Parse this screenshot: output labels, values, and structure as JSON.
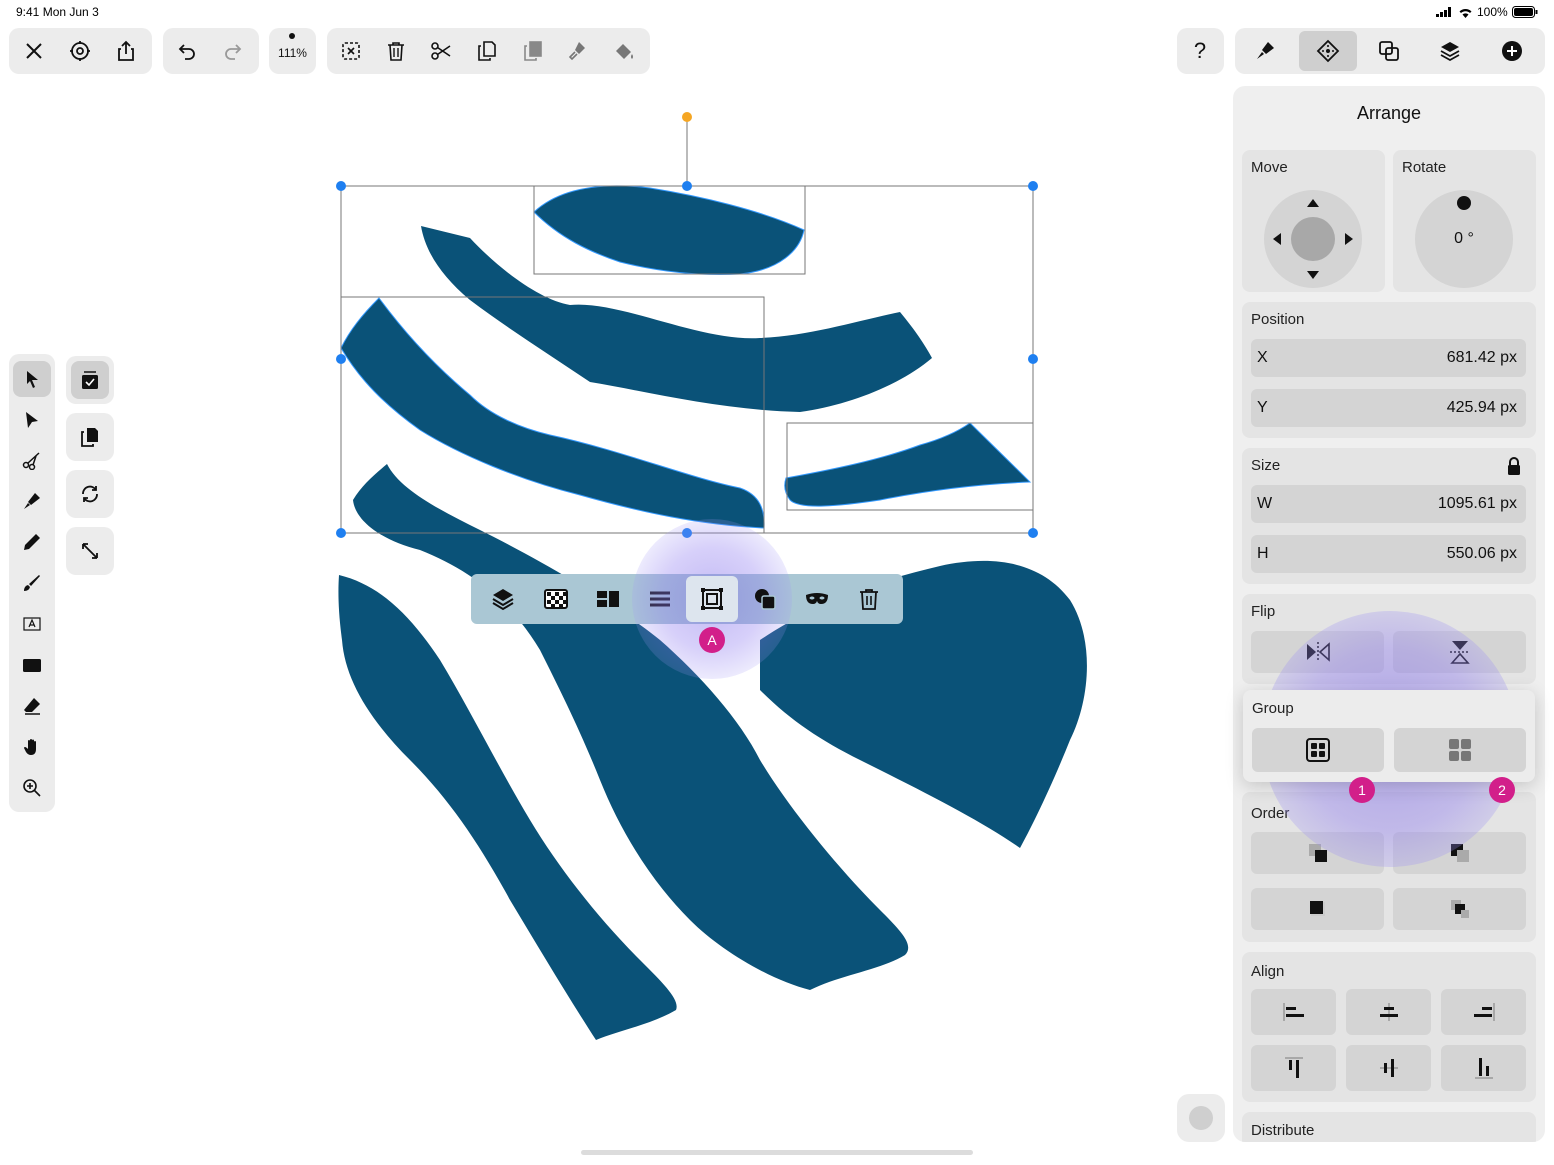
{
  "status": {
    "time": "9:41",
    "date": "Mon Jun 3",
    "battery": "100%"
  },
  "toolbar": {
    "zoom": "111%",
    "help_label": "?"
  },
  "panel": {
    "title": "Arrange",
    "move_label": "Move",
    "rotate_label": "Rotate",
    "rotate_value": "0 °",
    "position_label": "Position",
    "x_label": "X",
    "x_value": "681.42 px",
    "y_label": "Y",
    "y_value": "425.94 px",
    "size_label": "Size",
    "w_label": "W",
    "w_value": "1095.61 px",
    "h_label": "H",
    "h_value": "550.06 px",
    "flip_label": "Flip",
    "group_label": "Group",
    "order_label": "Order",
    "align_label": "Align",
    "distribute_label": "Distribute"
  },
  "badges": {
    "context": "A",
    "group_1": "1",
    "group_2": "2"
  },
  "colors": {
    "shape": "#0a5278",
    "handle": "#1e7ff0",
    "rotate_handle": "#f5a623",
    "badge": "#d21f8a",
    "context_bar": "#aac7d4",
    "highlight": "#8a7cf0"
  }
}
